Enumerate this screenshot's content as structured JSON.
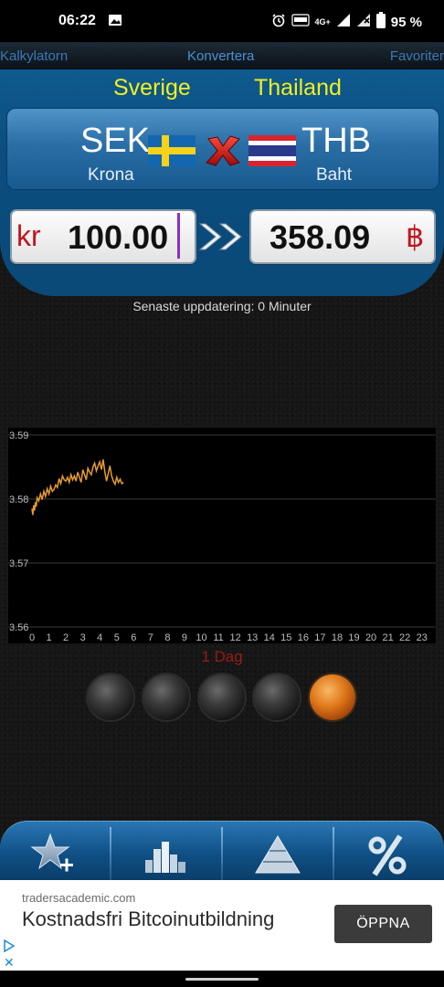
{
  "status_bar": {
    "time": "06:22",
    "battery": "95 %",
    "network": "4G+",
    "icons": [
      "image-icon",
      "alarm-icon",
      "volte-icon",
      "4g-icon",
      "signal-icon",
      "signal-off-icon",
      "battery-icon"
    ]
  },
  "nav": {
    "left": "Kalkylatorn",
    "center": "Konvertera",
    "right": "Favoriter"
  },
  "countries": {
    "from": "Sverige",
    "to": "Thailand"
  },
  "currency_from": {
    "code": "SEK",
    "name": "Krona",
    "symbol": "kr",
    "amount": "100.00"
  },
  "currency_to": {
    "code": "THB",
    "name": "Baht",
    "symbol": "฿",
    "amount": "358.09"
  },
  "update_text": "Senaste uppdatering: 0 Minuter",
  "period_label": "1 Dag",
  "period_buttons": [
    {
      "name": "period-1",
      "active": false
    },
    {
      "name": "period-2",
      "active": false
    },
    {
      "name": "period-3",
      "active": false
    },
    {
      "name": "period-4",
      "active": false
    },
    {
      "name": "period-5",
      "active": true
    }
  ],
  "colors": {
    "country_text": "#f3ef1e",
    "symbol_red": "#c0171f",
    "line": "#e69a2e",
    "nav_blue": "#3e78b4"
  },
  "chart_data": {
    "type": "line",
    "x_ticks": [
      "0",
      "1",
      "2",
      "3",
      "4",
      "5",
      "6",
      "7",
      "8",
      "9",
      "10",
      "11",
      "12",
      "13",
      "14",
      "15",
      "16",
      "17",
      "18",
      "19",
      "20",
      "21",
      "22",
      "23"
    ],
    "y_ticks": [
      "3.59",
      "3.58",
      "3.57",
      "3.56"
    ],
    "ylim": [
      3.56,
      3.59
    ],
    "xlim": [
      0,
      23.5
    ],
    "grid": true,
    "series": [
      {
        "x": [
          0.0,
          0.05,
          0.1,
          0.15,
          0.2,
          0.25,
          0.3,
          0.4,
          0.5,
          0.6,
          0.7,
          0.8,
          0.9,
          1.0,
          1.1,
          1.2,
          1.3,
          1.4,
          1.5,
          1.6,
          1.7,
          1.8,
          1.9,
          2.0,
          2.1,
          2.2,
          2.3,
          2.4,
          2.5,
          2.6,
          2.7,
          2.8,
          2.9,
          3.0,
          3.1,
          3.2,
          3.3,
          3.4,
          3.5,
          3.6,
          3.7,
          3.8,
          3.9,
          4.0,
          4.1,
          4.2,
          4.3,
          4.4,
          4.5,
          4.6,
          4.7,
          4.8,
          4.9,
          5.0,
          5.1,
          5.2,
          5.3,
          5.4
        ],
        "y": [
          3.5785,
          3.5775,
          3.579,
          3.5782,
          3.5795,
          3.5788,
          3.5802,
          3.5797,
          3.5808,
          3.5799,
          3.5812,
          3.5804,
          3.5816,
          3.5808,
          3.582,
          3.5812,
          3.5815,
          3.5822,
          3.5818,
          3.5832,
          3.5824,
          3.5836,
          3.583,
          3.5828,
          3.5834,
          3.5826,
          3.5838,
          3.583,
          3.5836,
          3.5828,
          3.5842,
          3.5834,
          3.5826,
          3.5846,
          3.5838,
          3.583,
          3.5848,
          3.5842,
          3.5838,
          3.585,
          3.5856,
          3.5844,
          3.5852,
          3.5858,
          3.5846,
          3.5862,
          3.5842,
          3.5828,
          3.584,
          3.5852,
          3.5836,
          3.5828,
          3.5823,
          3.5834,
          3.5826,
          3.5831,
          3.5824,
          3.5826
        ]
      }
    ]
  },
  "bottom_nav": [
    {
      "name": "favorites-add-icon"
    },
    {
      "name": "chart-icon"
    },
    {
      "name": "pyramid-icon"
    },
    {
      "name": "percent-icon"
    }
  ],
  "ad": {
    "url": "tradersacademic.com",
    "title": "Kostnadsfri Bitcoinutbildning",
    "button": "ÖPPNA"
  }
}
